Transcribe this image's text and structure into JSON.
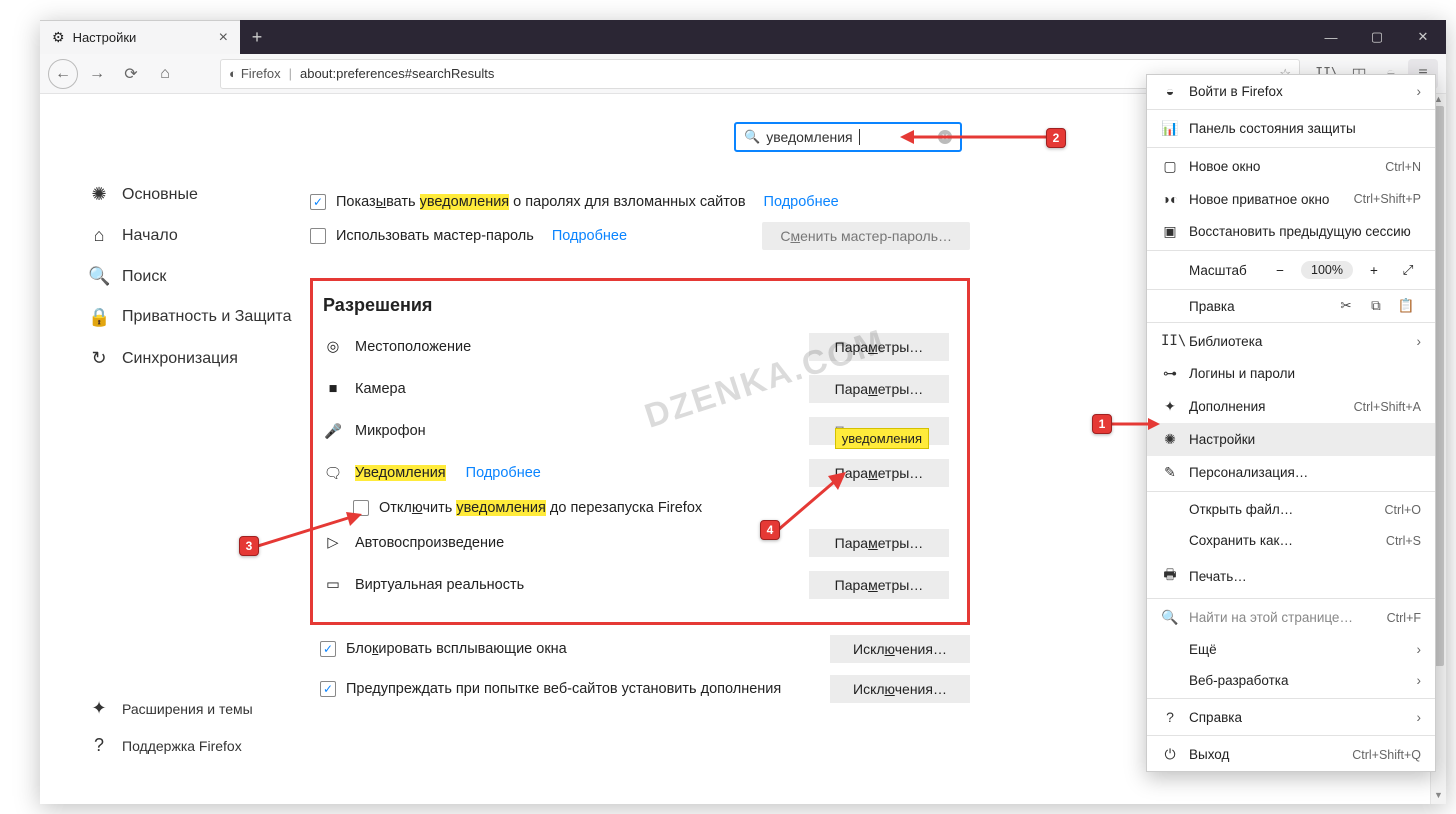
{
  "window": {
    "tab_title": "Настройки"
  },
  "navbar": {
    "firefox_label": "Firefox",
    "url": "about:preferences#searchResults"
  },
  "sidebar": {
    "items": [
      {
        "icon": "gear",
        "label": "Основные"
      },
      {
        "icon": "home",
        "label": "Начало"
      },
      {
        "icon": "search",
        "label": "Поиск"
      },
      {
        "icon": "lock",
        "label": "Приватность и Защита"
      },
      {
        "icon": "sync",
        "label": "Синхронизация"
      }
    ],
    "footer": [
      {
        "icon": "puzzle",
        "label": "Расширения и темы"
      },
      {
        "icon": "help",
        "label": "Поддержка Firefox"
      }
    ]
  },
  "search": {
    "value": "уведомления"
  },
  "prefs": {
    "breached_prefix": "Показ",
    "breached_u": "ы",
    "breached_mid": "вать ",
    "breached_hl": "уведомления",
    "breached_suffix": " о паролях для взломанных сайтов",
    "more": "Подробнее",
    "master_pw": "Использовать мастер-пароль",
    "change_master_prefix": "С",
    "change_master_u": "м",
    "change_master_suffix": "енить мастер-пароль…",
    "permissions_title": "Разрешения",
    "perm_location": "Местоположение",
    "perm_camera": "Камера",
    "perm_microphone": "Микрофон",
    "perm_notifications": "Уведомления",
    "perm_notifications_pause_prefix": "Откл",
    "perm_notifications_pause_u": "ю",
    "perm_notifications_pause_mid": "чить ",
    "perm_notifications_pause_hl": "уведомления",
    "perm_notifications_pause_suffix": " до перезапуска Firefox",
    "perm_autoplay": "Автовоспроизведение",
    "perm_vr": "Виртуальная реальность",
    "param_prefix": "Пара",
    "param_u": "м",
    "param_suffix": "етры…",
    "tooltip_notif": "уведомления",
    "block_popups_prefix": "Бло",
    "block_popups_u": "к",
    "block_popups_suffix": "ировать всплывающие окна",
    "warn_addons_prefix": "Пре",
    "warn_addons_u": "д",
    "warn_addons_suffix": "упреждать при попытке веб-сайтов установить дополнения",
    "exceptions_prefix": "Искл",
    "exceptions_u": "ю",
    "exceptions_suffix": "чения…"
  },
  "menu": {
    "signin": "Войти в Firefox",
    "protection": "Панель состояния защиты",
    "new_window": "Новое окно",
    "new_window_sc": "Ctrl+N",
    "new_private": "Новое приватное окно",
    "new_private_sc": "Ctrl+Shift+P",
    "restore": "Восстановить предыдущую сессию",
    "zoom": "Масштаб",
    "zoom_pct": "100%",
    "edit": "Правка",
    "library": "Библиотека",
    "logins": "Логины и пароли",
    "addons": "Дополнения",
    "addons_sc": "Ctrl+Shift+A",
    "settings": "Настройки",
    "customize": "Персонализация…",
    "open_file": "Открыть файл…",
    "open_file_sc": "Ctrl+O",
    "save_as": "Сохранить как…",
    "save_as_sc": "Ctrl+S",
    "print": "Печать…",
    "find": "Найти на этой странице…",
    "find_sc": "Ctrl+F",
    "more": "Ещё",
    "webdev": "Веб-разработка",
    "help": "Справка",
    "exit": "Выход",
    "exit_sc": "Ctrl+Shift+Q"
  },
  "watermark": "DZENKA.COM",
  "callouts": {
    "c1": "1",
    "c2": "2",
    "c3": "3",
    "c4": "4"
  }
}
